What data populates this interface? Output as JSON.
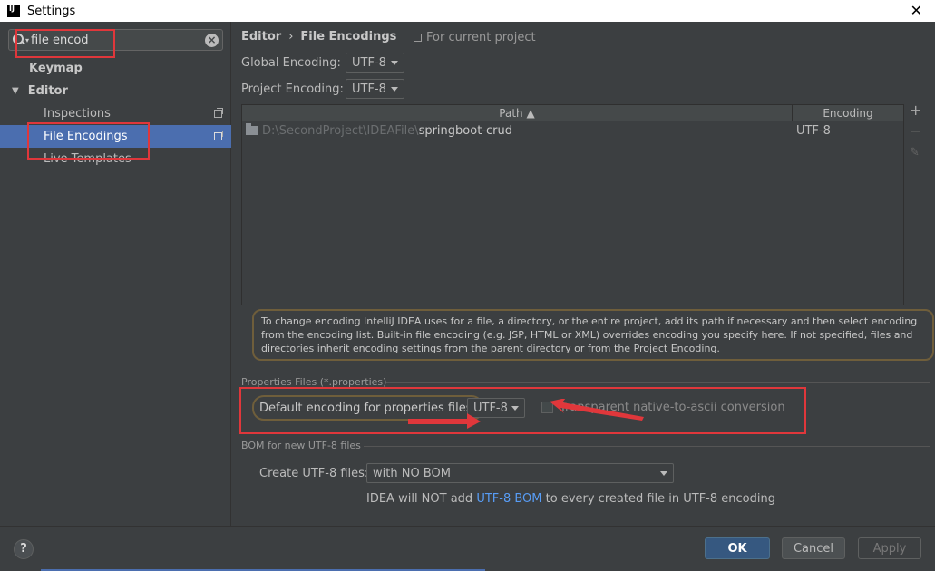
{
  "window": {
    "title": "Settings",
    "app_icon": "IJ"
  },
  "sidebar": {
    "search_value": "file encod",
    "items": [
      {
        "label": "Keymap"
      },
      {
        "label": "Editor"
      },
      {
        "label": "Inspections"
      },
      {
        "label": "File Encodings"
      },
      {
        "label": "Live Templates"
      }
    ]
  },
  "main": {
    "breadcrumb": {
      "parent": "Editor",
      "separator": "›",
      "current": "File Encodings"
    },
    "scope_hint": "For current project",
    "global_encoding": {
      "label": "Global Encoding:",
      "value": "UTF-8"
    },
    "project_encoding": {
      "label": "Project Encoding:",
      "value": "UTF-8"
    },
    "table": {
      "columns": {
        "path": "Path ▲",
        "encoding": "Encoding"
      },
      "rows": [
        {
          "path_prefix": "D:\\SecondProject\\IDEAFile\\",
          "path_name": "springboot-crud",
          "encoding": "UTF-8"
        }
      ],
      "tools": {
        "add": "+",
        "remove": "−",
        "edit": "✎"
      }
    },
    "info_text": "To change encoding IntelliJ IDEA uses for a file, a directory, or the entire project, add its path if necessary and then select encoding from the encoding list. Built-in file encoding (e.g. JSP, HTML or XML) overrides encoding you specify here. If not specified, files and directories inherit encoding settings from the parent directory or from the Project Encoding.",
    "properties": {
      "section_title": "Properties Files (*.properties)",
      "default_label": "Default encoding for properties files:",
      "default_value": "UTF-8",
      "native_to_ascii_label": "Transparent native-to-ascii conversion",
      "native_to_ascii_checked": false
    },
    "bom": {
      "section_title": "BOM for new UTF-8 files",
      "create_label": "Create UTF-8 files:",
      "create_value": "with NO BOM",
      "hint_pre": "IDEA will NOT add ",
      "hint_link": "UTF-8 BOM",
      "hint_post": " to every created file in UTF-8 encoding"
    }
  },
  "footer": {
    "help": "?",
    "ok": "OK",
    "cancel": "Cancel",
    "apply": "Apply"
  },
  "colors": {
    "accent": "#4b6eaf",
    "annotation": "#e0373b",
    "link": "#589df6"
  }
}
